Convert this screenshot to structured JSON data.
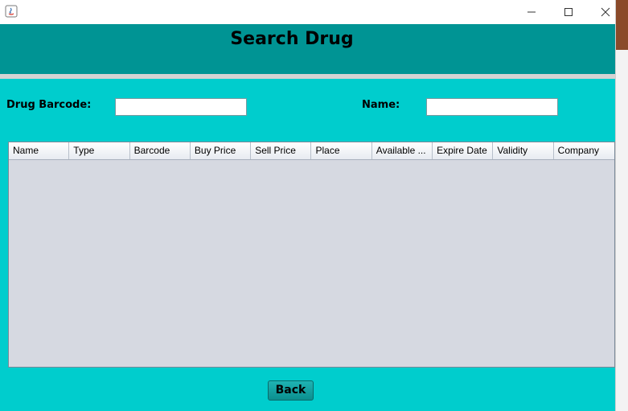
{
  "window": {
    "controls": {
      "minimize_icon": "minimize-icon",
      "maximize_icon": "maximize-icon",
      "close_icon": "close-icon"
    }
  },
  "header": {
    "title": "Search Drug"
  },
  "form": {
    "barcode_label": "Drug Barcode:",
    "barcode_value": "",
    "name_label": "Name:",
    "name_value": ""
  },
  "table": {
    "columns": [
      "Name",
      "Type",
      "Barcode",
      "Buy Price",
      "Sell Price",
      "Place",
      "Available ...",
      "Expire Date",
      "Validity",
      "Company"
    ],
    "rows": []
  },
  "buttons": {
    "back_label": "Back"
  },
  "colors": {
    "content_bg": "#00cdcd",
    "header_bg": "#009494",
    "table_bg": "#d6d9e1"
  }
}
